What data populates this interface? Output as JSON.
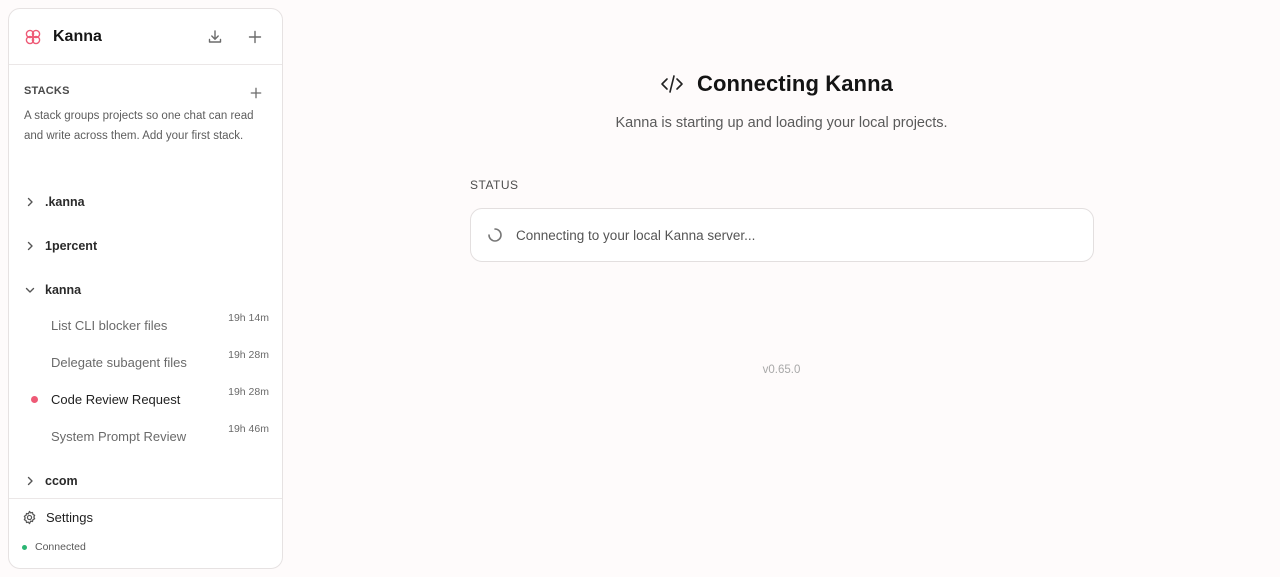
{
  "app": {
    "name": "Kanna",
    "accent": "#ee5a76"
  },
  "sidebar": {
    "header_icons": [
      "download-icon",
      "plus-icon"
    ],
    "stacks": {
      "heading": "STACKS",
      "description": "A stack groups projects so one chat can read and write across them. Add your first stack."
    },
    "projects": [
      {
        "name": ".kanna",
        "expanded": false
      },
      {
        "name": "1percent",
        "expanded": false
      },
      {
        "name": "kanna",
        "expanded": true,
        "chats": [
          {
            "title": "List CLI blocker files",
            "time": "19h 14m",
            "unread": false
          },
          {
            "title": "Delegate subagent files",
            "time": "19h 28m",
            "unread": false
          },
          {
            "title": "Code Review Request",
            "time": "19h 28m",
            "unread": true
          },
          {
            "title": "System Prompt Review",
            "time": "19h 46m",
            "unread": false
          }
        ]
      },
      {
        "name": "ccom",
        "expanded": false
      }
    ],
    "footer": {
      "settings_label": "Settings",
      "connection_label": "Connected",
      "connection_color": "#2bb673"
    }
  },
  "main": {
    "title": "Connecting Kanna",
    "subtitle": "Kanna is starting up and loading your local projects.",
    "status_heading": "STATUS",
    "status_message": "Connecting to your local Kanna server...",
    "version": "v0.65.0"
  }
}
